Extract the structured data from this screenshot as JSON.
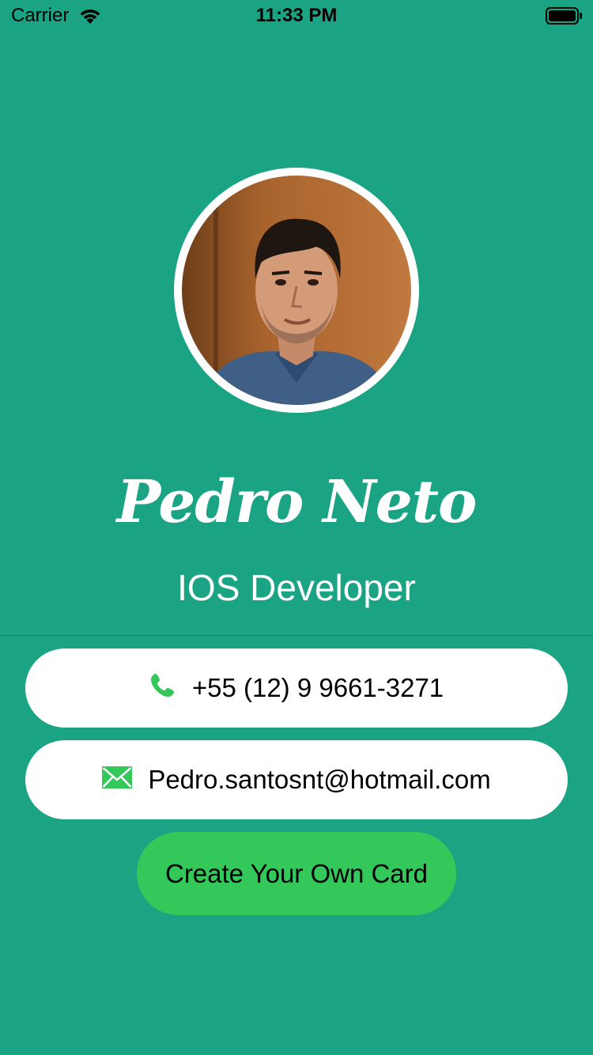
{
  "status_bar": {
    "carrier": "Carrier",
    "time": "11:33 PM",
    "wifi_icon": "wifi-icon",
    "battery_icon": "battery-icon"
  },
  "profile": {
    "name": "Pedro Neto",
    "title": "IOS Developer",
    "avatar_icon": "profile-photo"
  },
  "contacts": {
    "phone": {
      "icon": "phone-icon",
      "value": "+55 (12) 9 9661-3271"
    },
    "email": {
      "icon": "envelope-icon",
      "value": "Pedro.santosnt@hotmail.com"
    }
  },
  "actions": {
    "create_card_label": "Create Your Own Card"
  },
  "colors": {
    "background": "#1aa484",
    "pill": "#ffffff",
    "button": "#34c759",
    "icon_green": "#34c759"
  }
}
